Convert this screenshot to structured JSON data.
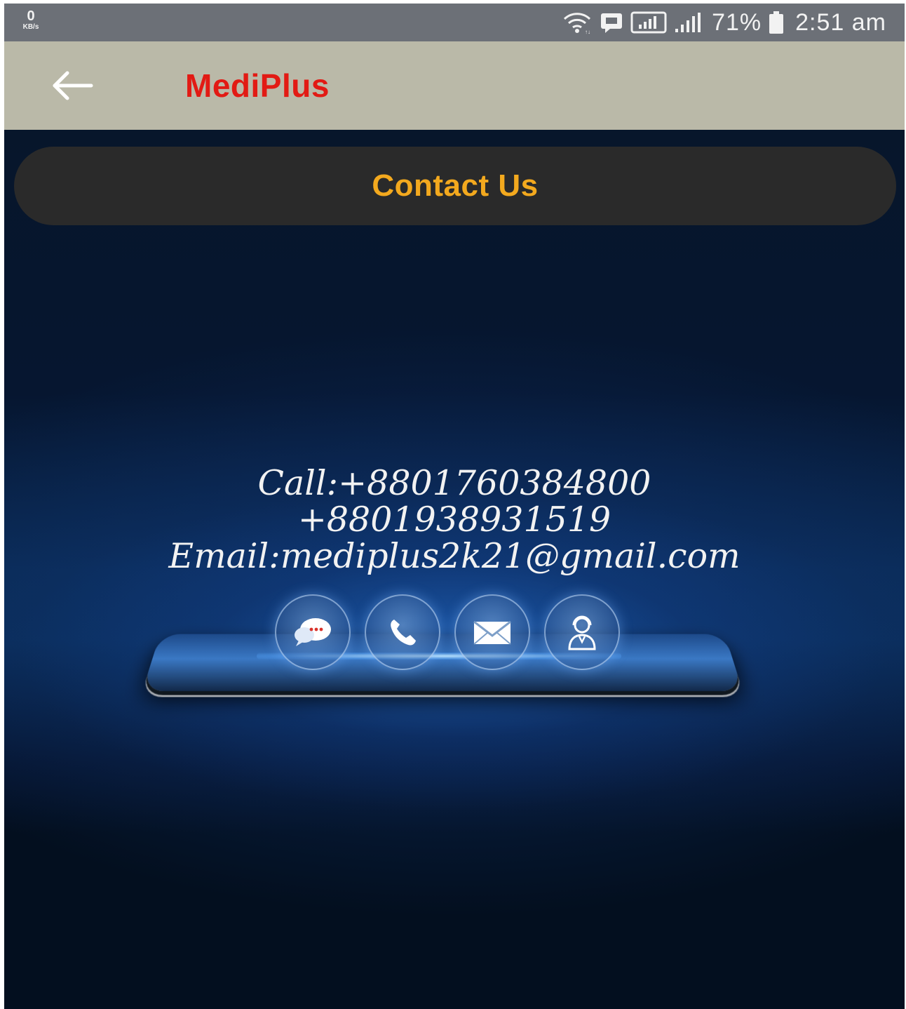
{
  "status_bar": {
    "net_speed_value": "0",
    "net_speed_unit": "KB/s",
    "battery": "71%",
    "time": "2:51 am",
    "icons": [
      "wifi-icon",
      "message-icon",
      "sim-signal-icon",
      "signal-icon",
      "battery-icon"
    ]
  },
  "app_bar": {
    "back_icon": "arrow-left-icon",
    "title": "MediPlus",
    "title_color": "#e21a14",
    "background": "#bab9a8"
  },
  "contact": {
    "heading": "Contact Us",
    "heading_color": "#f3a91e",
    "call": "Call:+8801760384800",
    "phone2": "+8801938931519",
    "email": "Email:mediplus2k21@gmail.com"
  },
  "illustration": {
    "icons": [
      "chat-icon",
      "phone-icon",
      "mail-icon",
      "support-agent-icon"
    ]
  }
}
